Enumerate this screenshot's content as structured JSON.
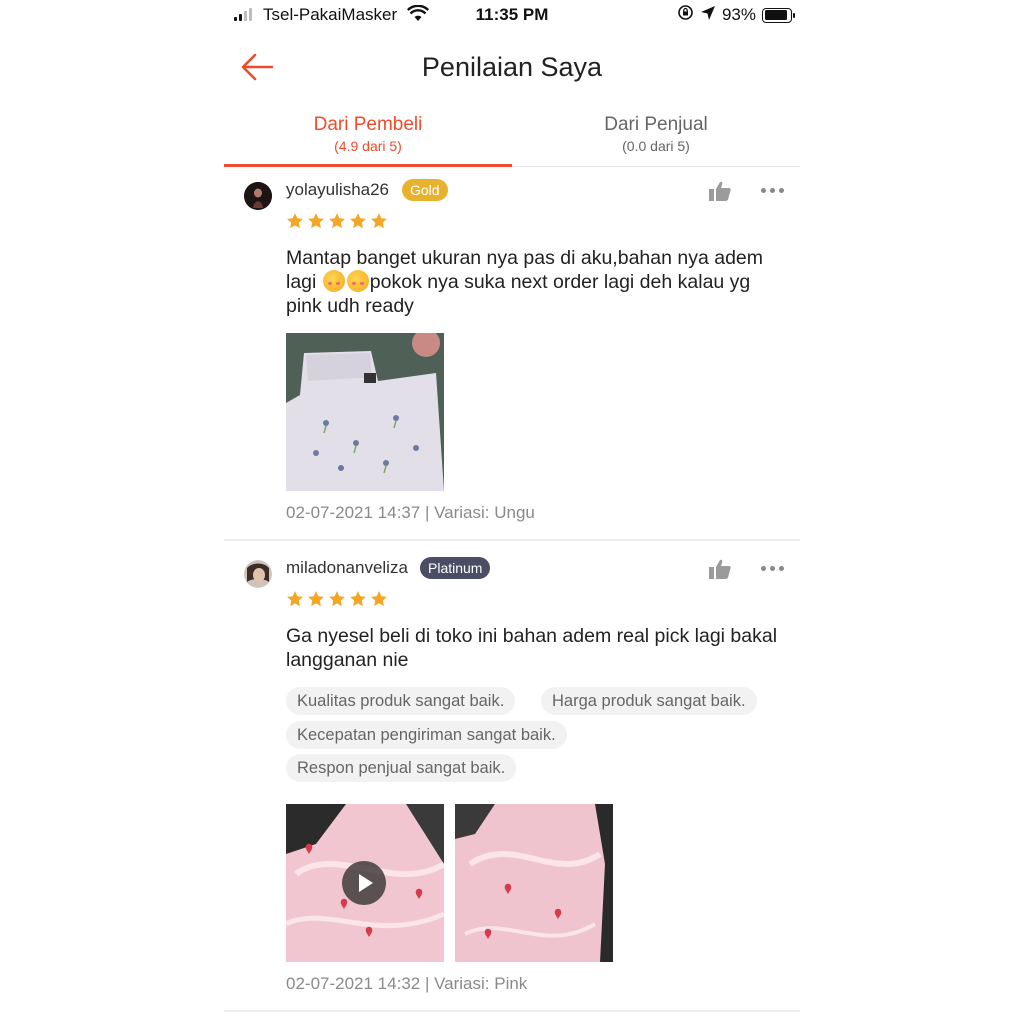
{
  "status_bar": {
    "carrier": "Tsel-PakaiMasker",
    "time": "11:35 PM",
    "battery": "93%",
    "battery_level": 0.93
  },
  "header": {
    "title": "Penilaian Saya",
    "back_icon": "arrow-left-icon"
  },
  "tabs": [
    {
      "label": "Dari Pembeli",
      "sub": "(4.9 dari 5)",
      "active": true
    },
    {
      "label": "Dari Penjual",
      "sub": "(0.0 dari 5)",
      "active": false
    }
  ],
  "colors": {
    "accent": "#ee4d2d",
    "star": "#f5a623",
    "gold_badge": "#e8b22f",
    "platinum_badge": "#4a4d63"
  },
  "reviews": [
    {
      "username": "yolayulisha26",
      "badge": "Gold",
      "rating": 5,
      "text_part1": "Mantap banget ukuran nya pas di aku,bahan nya adem lagi ",
      "text_part2": "pokok nya suka next order lagi deh kalau yg pink udh ready",
      "emoji_count": 2,
      "tags": [],
      "media": [
        {
          "type": "photo"
        }
      ],
      "meta": "02-07-2021 14:37 | Variasi: Ungu"
    },
    {
      "username": "miladonanveliza",
      "badge": "Platinum",
      "rating": 5,
      "text": "Ga nyesel beli di toko ini bahan adem real pick lagi bakal langganan nie",
      "tags": [
        "Kualitas produk sangat baik.",
        "Harga produk sangat baik.",
        "Kecepatan pengiriman sangat baik.",
        "Respon penjual sangat baik."
      ],
      "media": [
        {
          "type": "video"
        },
        {
          "type": "photo"
        }
      ],
      "meta": "02-07-2021 14:32 | Variasi: Pink"
    }
  ]
}
